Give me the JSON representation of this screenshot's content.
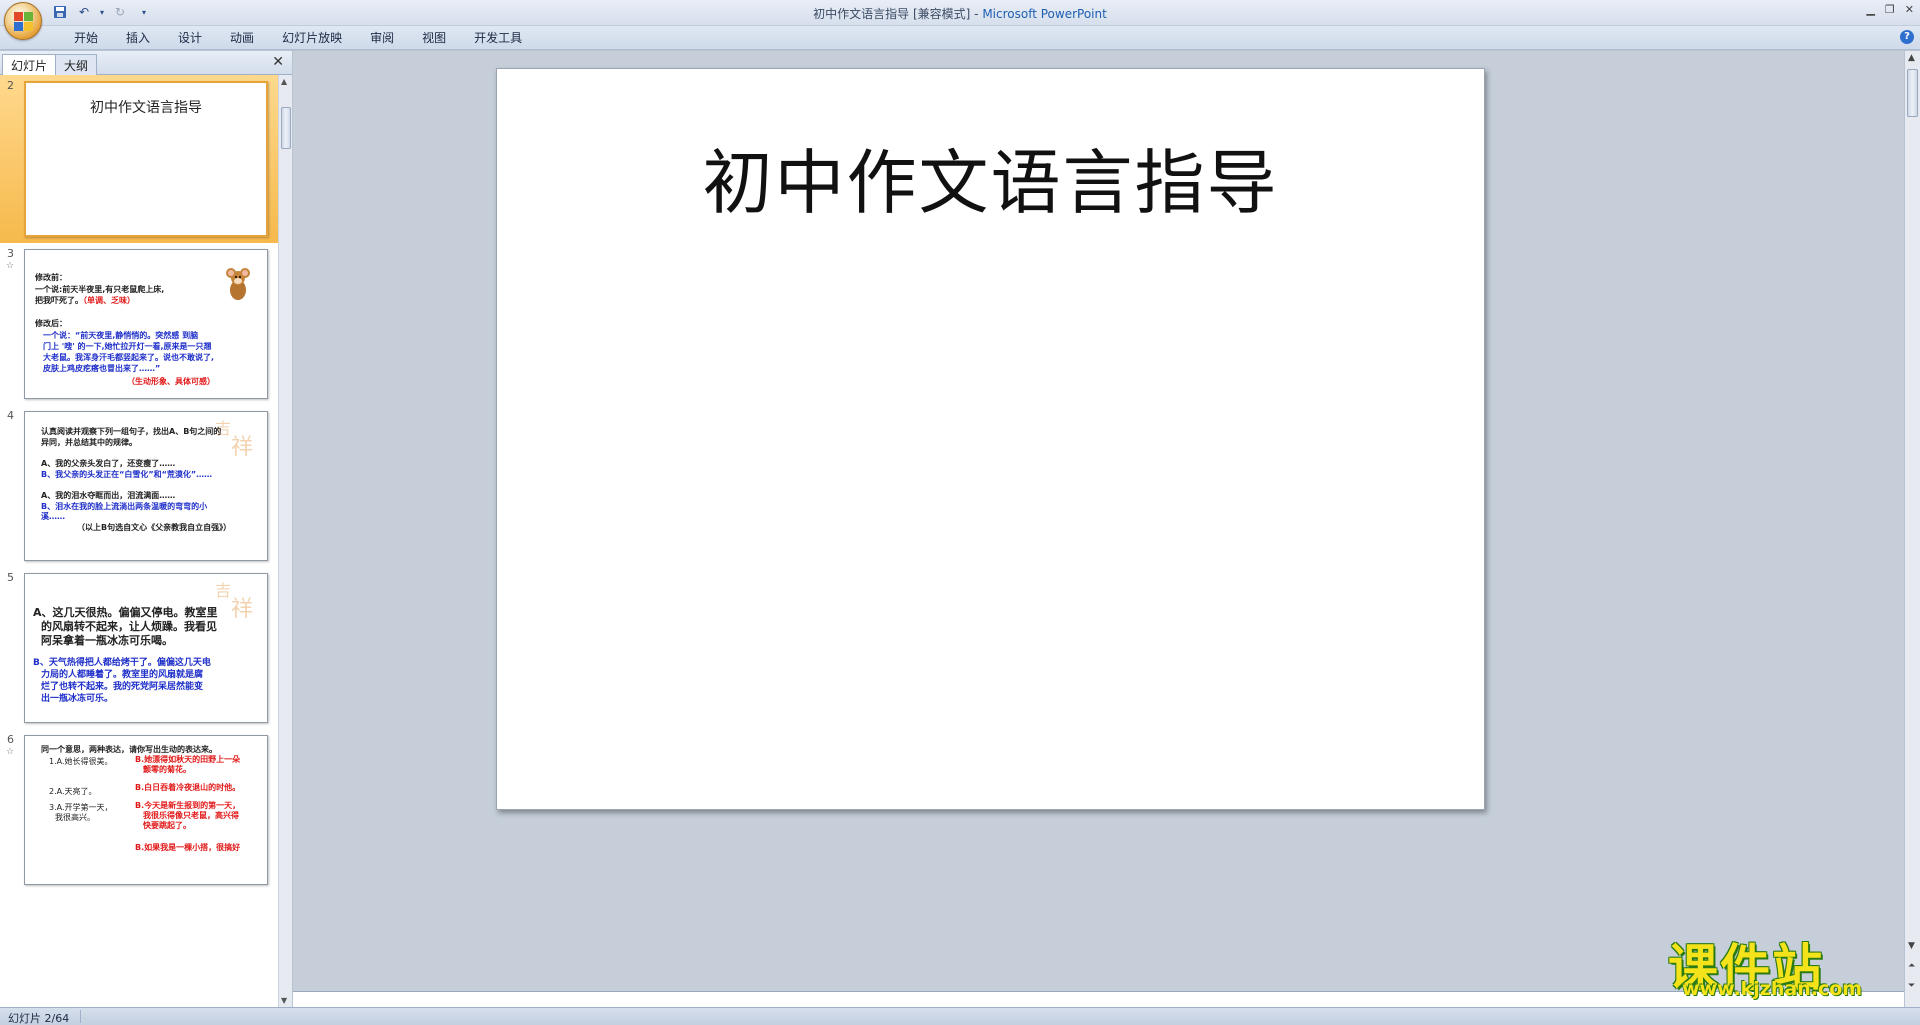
{
  "window": {
    "title": "初中作文语言指导 [兼容模式]",
    "separator": " - ",
    "app_name": "Microsoft PowerPoint"
  },
  "ribbon": {
    "tabs": [
      "开始",
      "插入",
      "设计",
      "动画",
      "幻灯片放映",
      "审阅",
      "视图",
      "开发工具"
    ]
  },
  "left_pane": {
    "tabs": [
      "幻灯片",
      "大纲"
    ],
    "close": "✕"
  },
  "thumbnails": [
    {
      "number": "2",
      "title": "初中作文语言指导"
    },
    {
      "number": "3",
      "lines": [
        "修改前：",
        "一个说:前天半夜里,有只老鼠爬上床,",
        "把我吓死了。",
        "（单调、乏味）",
        "修改后：",
        "一个说：“前天夜里,静悄悄的。突然感 到脑",
        "门上 '嗖' 的一下,她忙拉开灯一看,原来是一只翘",
        "大老鼠。我浑身汗毛都竖起来了。说也不敢说了,",
        "皮肤上鸡皮疙瘩也冒出来了……”",
        "（生动形象、具体可感）"
      ]
    },
    {
      "number": "4",
      "lines": [
        "认真阅读并观察下列一组句子，找出A、B句之间的",
        "异同，并总结其中的规律。",
        "A、我的父亲头发白了，还变瘦了……",
        "B、我父亲的头发正在“白雪化”和“荒漠化”……",
        "A、我的泪水夺眶而出，泪流满面……",
        "B、泪水在我的脸上流淌出两条温暖的弯弯的小",
        "溪……",
        "（以上B句选自文心《父亲教我自立自强》）"
      ]
    },
    {
      "number": "5",
      "lines": [
        "A、这几天很热。偏偏又停电。教室里",
        "的风扇转不起来，让人烦躁。我看见",
        "阿呆拿着一瓶冰冻可乐喝。",
        "B、天气热得把人都给烤干了。偏偏这几天电",
        "力局的人都睡着了。教室里的风扇就是腐",
        "烂了也转不起来。我的死党阿呆居然能变",
        "出一瓶冰冻可乐。"
      ]
    },
    {
      "number": "6",
      "lines": [
        "同一个意思，两种表达，请你写出生动的表达来。",
        "1.A.她长得很美。",
        "B.她漂得如秋天的田野上一朵",
        "颤零的菊花。",
        "2.A.天亮了。",
        "B.白日吞着冷夜退山的时他。",
        "3.A.开学第一天，",
        "我很高兴。",
        "B.今天是新生报到的第一天，",
        "我很乐得像只老鼠，高兴得",
        "快要跳起了。",
        "B.如果我是一棵小搭，很搞好"
      ]
    }
  ],
  "main_slide": {
    "title": "初中作文语言指导"
  },
  "status": {
    "slide_counter": "幻灯片 2/64"
  },
  "watermark": {
    "text": "课件站",
    "url": "www.kjzhan.com"
  },
  "colors": {
    "selected_thumb": "#f6b94c",
    "blue_text": "#1f2fc9",
    "red_text": "#e11919",
    "watermark_yellow": "#f4e21a"
  }
}
